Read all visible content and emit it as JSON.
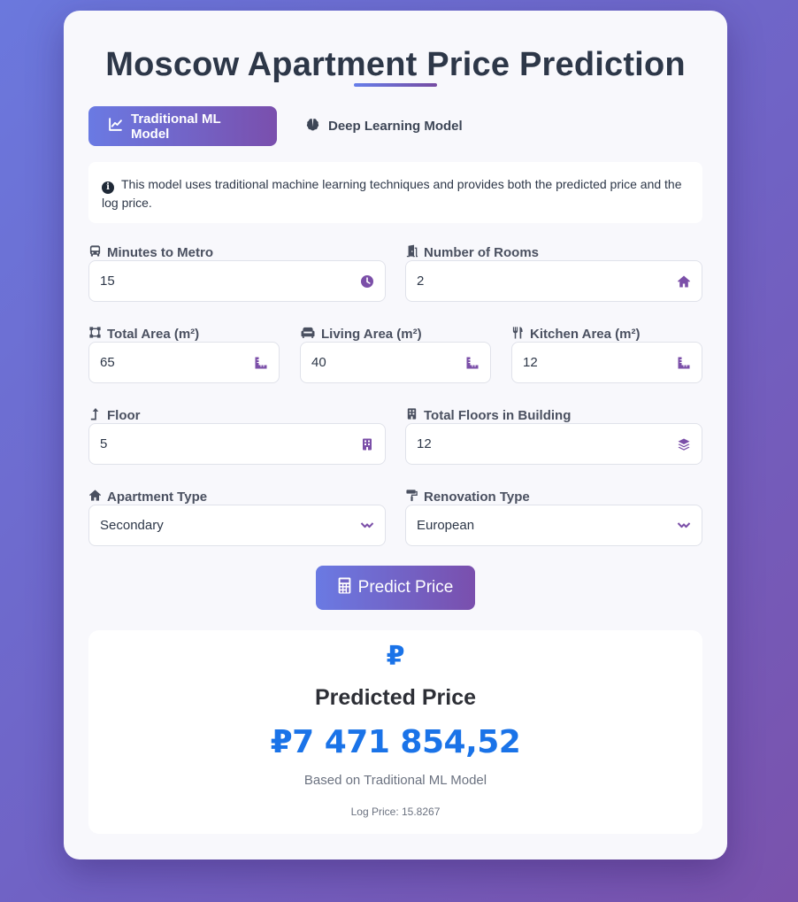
{
  "header": {
    "title": "Moscow Apartment Price Prediction"
  },
  "tabs": [
    {
      "label": "Traditional ML Model",
      "icon": "chart-line-icon",
      "active": true
    },
    {
      "label": "Deep Learning Model",
      "icon": "brain-icon",
      "active": false
    }
  ],
  "info": {
    "icon": "info-circle-icon",
    "text": "This model uses traditional machine learning techniques and provides both the predicted price and the log price."
  },
  "form": {
    "minutes_to_metro": {
      "label": "Minutes to Metro",
      "value": "15",
      "label_icon": "bus-icon",
      "field_icon": "clock-icon"
    },
    "number_of_rooms": {
      "label": "Number of Rooms",
      "value": "2",
      "label_icon": "door-icon",
      "field_icon": "home-icon"
    },
    "total_area": {
      "label": "Total Area (m²)",
      "value": "65",
      "label_icon": "vector-square-icon",
      "field_icon": "ruler-icon"
    },
    "living_area": {
      "label": "Living Area (m²)",
      "value": "40",
      "label_icon": "couch-icon",
      "field_icon": "ruler-icon"
    },
    "kitchen_area": {
      "label": "Kitchen Area (m²)",
      "value": "12",
      "label_icon": "utensils-icon",
      "field_icon": "ruler-icon"
    },
    "floor": {
      "label": "Floor",
      "value": "5",
      "label_icon": "level-up-icon",
      "field_icon": "building-icon"
    },
    "total_floors": {
      "label": "Total Floors in Building",
      "value": "12",
      "label_icon": "building-icon",
      "field_icon": "layers-icon"
    },
    "apartment_type": {
      "label": "Apartment Type",
      "value": "Secondary",
      "label_icon": "home-icon",
      "field_icon": "chevron-down-icon"
    },
    "renovation_type": {
      "label": "Renovation Type",
      "value": "European",
      "label_icon": "paint-roller-icon",
      "field_icon": "chevron-down-icon"
    }
  },
  "predict_button": {
    "label": "Predict Price",
    "icon": "calculator-icon"
  },
  "result": {
    "icon": "₽",
    "title": "Predicted Price",
    "price": "₽7 471 854,52",
    "basis": "Based on Traditional ML Model",
    "log_price": "Log Price: 15.8267"
  },
  "colors": {
    "accent_start": "#667eea",
    "accent_end": "#764ba2",
    "price_blue": "#1a73e8",
    "icon_purple": "#7b4fa8"
  }
}
